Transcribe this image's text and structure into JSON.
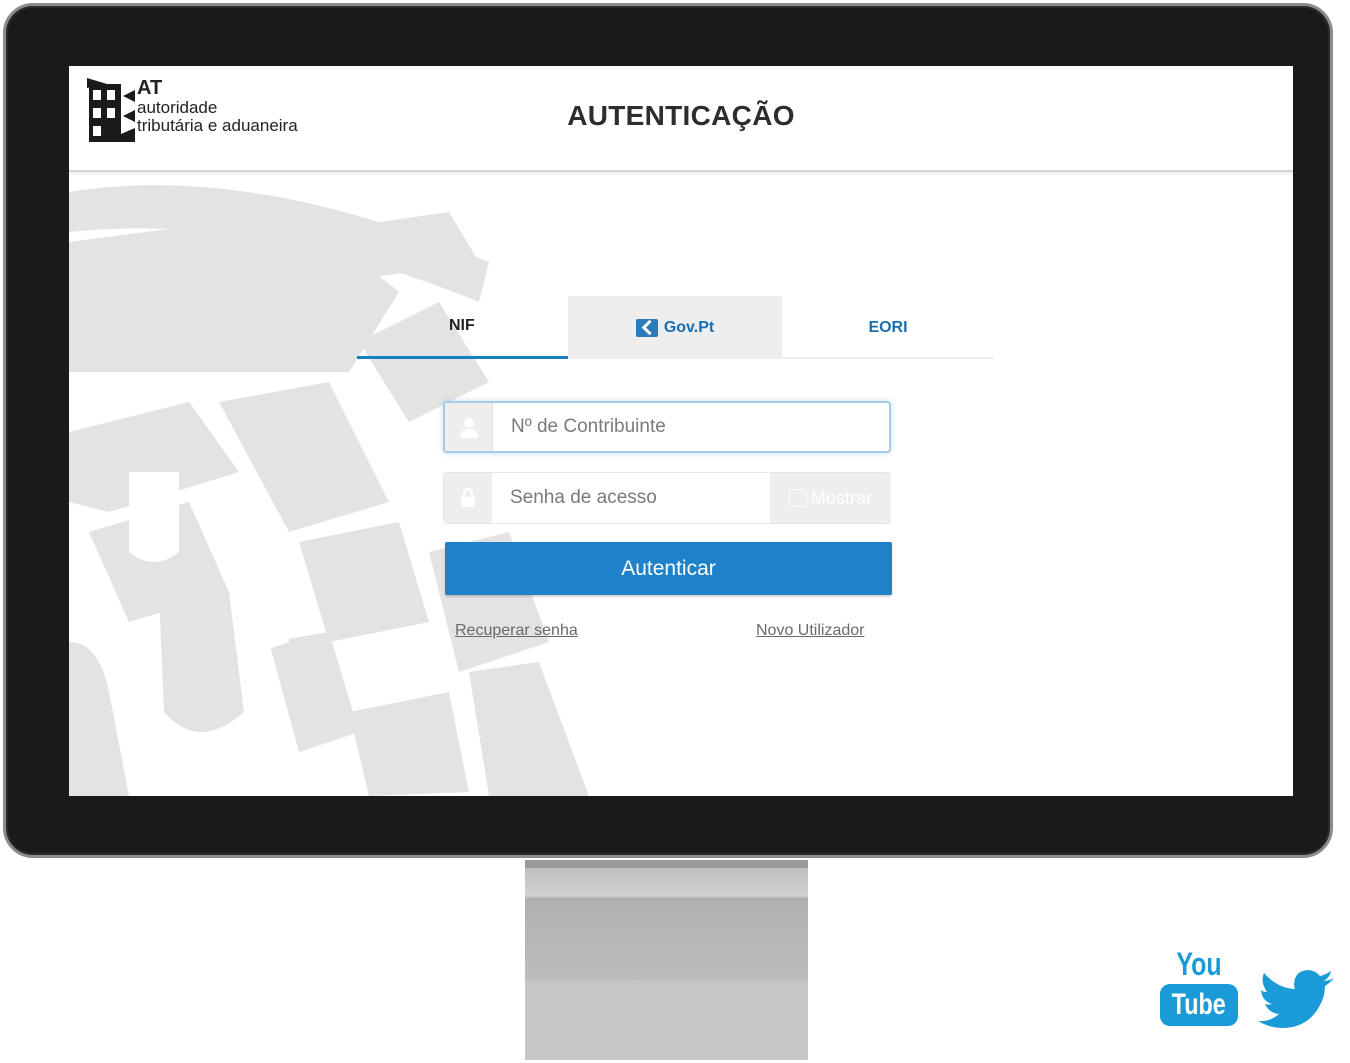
{
  "header": {
    "logo": {
      "abbr": "AT",
      "line1": "autoridade",
      "line2": "tributária e aduaneira"
    },
    "title": "AUTENTICAÇÃO"
  },
  "tabs": {
    "nif": "NIF",
    "govpt": "Gov.Pt",
    "eori": "EORI",
    "active": "NIF"
  },
  "form": {
    "nif_placeholder": "Nº de Contribuinte",
    "nif_value": "",
    "password_placeholder": "Senha de acesso",
    "password_value": "",
    "show_label": "Mostrar",
    "submit_label": "Autenticar"
  },
  "links": {
    "recover": "Recuperar senha",
    "new_user": "Novo Utilizador"
  },
  "social": {
    "youtube_top": "You",
    "youtube_bottom": "Tube",
    "icons": [
      "youtube-icon",
      "twitter-icon"
    ]
  },
  "colors": {
    "primary": "#1f82c9",
    "tab_text": "#1a6fb0",
    "social": "#1a9bd7"
  }
}
